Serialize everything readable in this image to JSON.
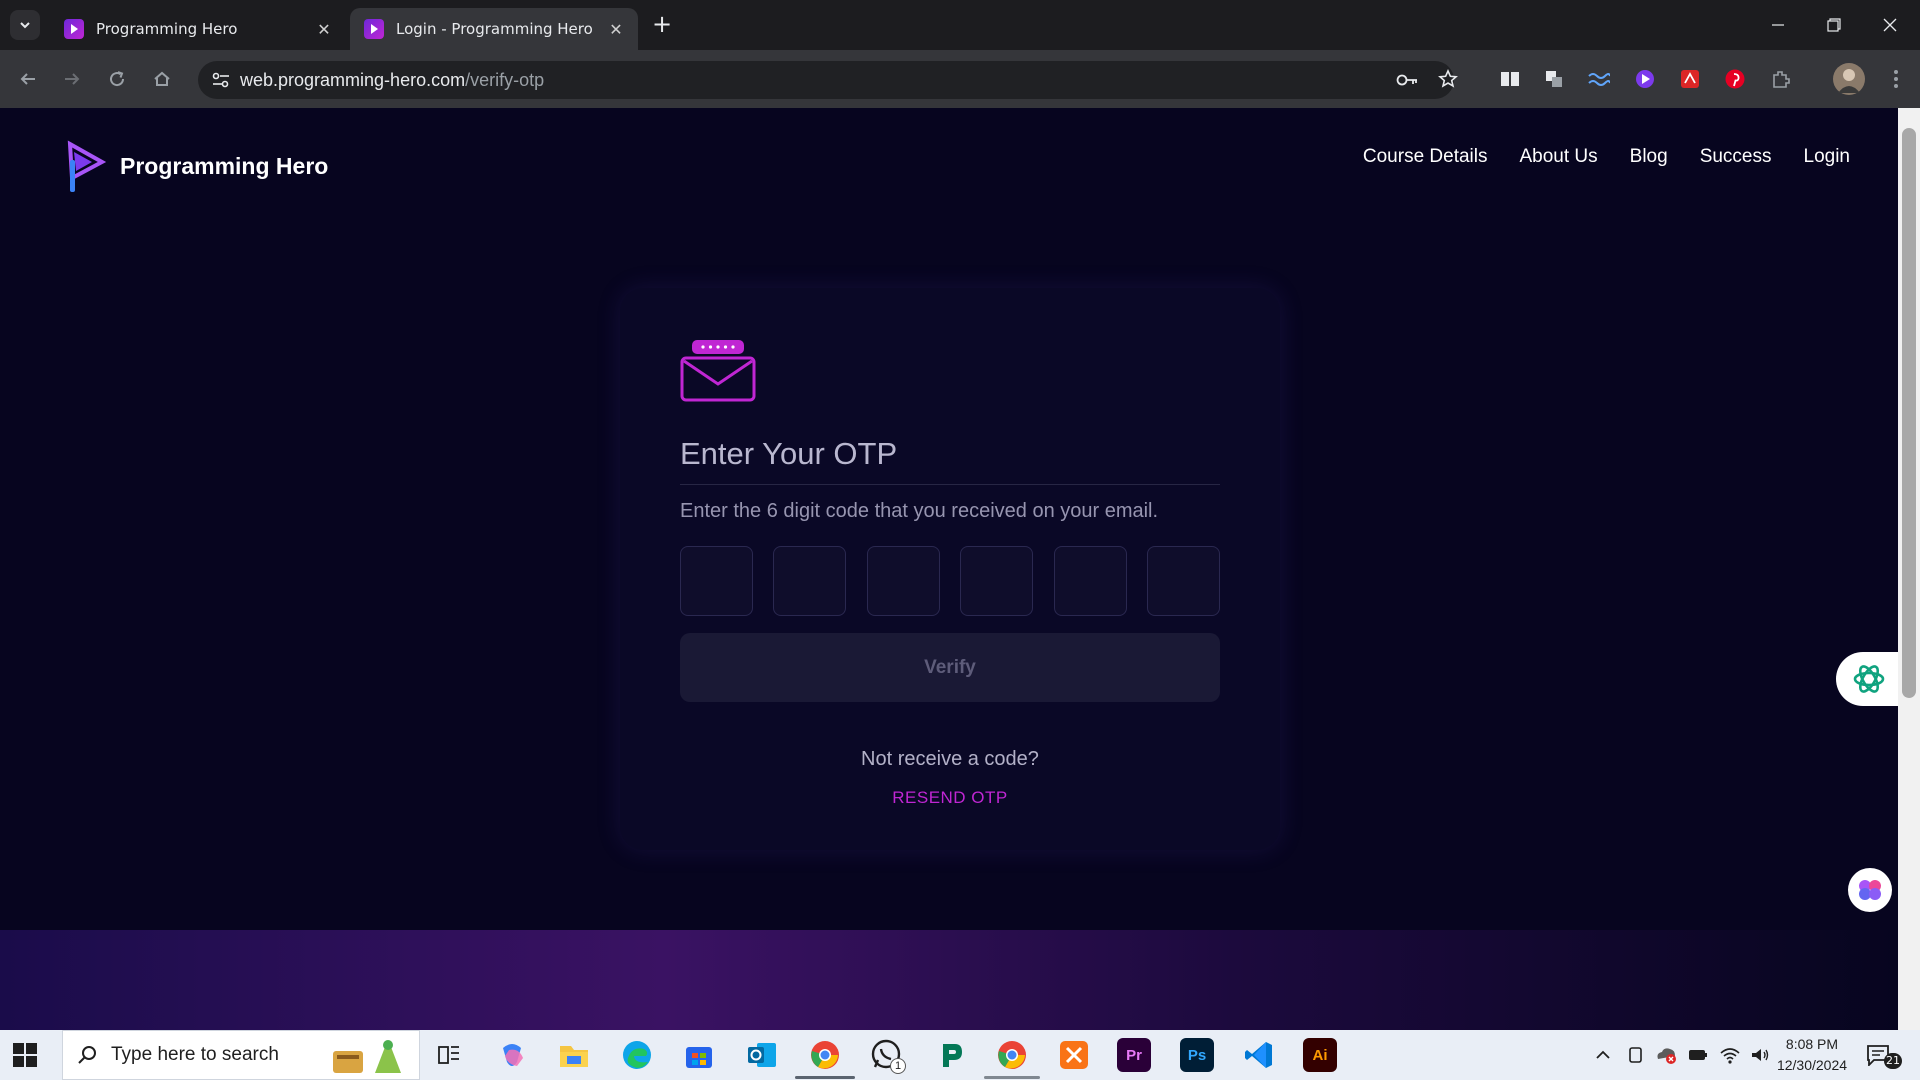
{
  "browser": {
    "tabs": [
      {
        "title": "Programming Hero",
        "active": false
      },
      {
        "title": "Login - Programming Hero",
        "active": true
      }
    ],
    "url_host": "web.programming-hero.com",
    "url_path": "/verify-otp"
  },
  "site": {
    "brand": "Programming Hero",
    "nav": [
      "Course Details",
      "About Us",
      "Blog",
      "Success",
      "Login"
    ]
  },
  "otp_card": {
    "title": "Enter Your OTP",
    "subtitle": "Enter the 6 digit code that you received on your email.",
    "digits": [
      "",
      "",
      "",
      "",
      "",
      ""
    ],
    "verify_label": "Verify",
    "no_code_text": "Not receive a code?",
    "resend_label": "RESEND OTP"
  },
  "taskbar": {
    "search_placeholder": "Type here to search",
    "time": "8:08 PM",
    "date": "12/30/2024",
    "notifications": "21",
    "whatsapp_badge": "1"
  },
  "colors": {
    "page_bg": "#07051f",
    "accent": "#c026d3",
    "brand_purple": "#7c3aed"
  }
}
